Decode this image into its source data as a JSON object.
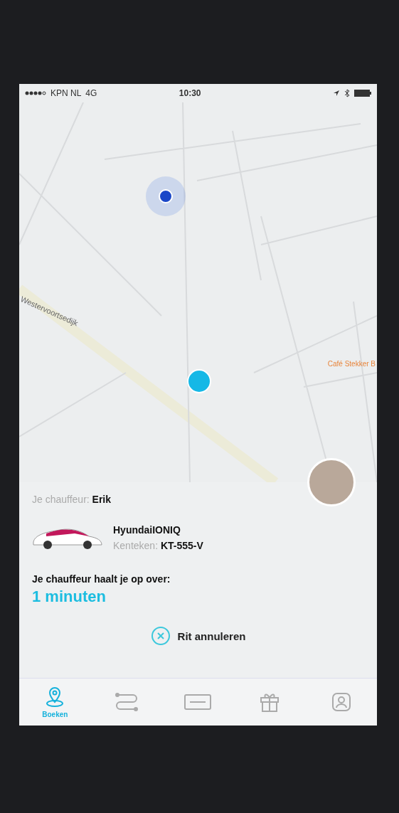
{
  "status_bar": {
    "carrier": "KPN NL",
    "network": "4G",
    "time": "10:30"
  },
  "map": {
    "street_label": "Westervoortsedijk",
    "poi_label": "Café Stekker B"
  },
  "driver": {
    "label": "Je chauffeur:",
    "name": "Erik"
  },
  "car": {
    "model": "HyundaiIONIQ",
    "plate_label": "Kenteken:",
    "plate": "KT-555-V"
  },
  "pickup": {
    "label": "Je chauffeur haalt je op over:",
    "eta": "1 minuten"
  },
  "cancel_button": {
    "label": "Rit annuleren"
  },
  "tabs": [
    {
      "kind": "pin",
      "label": "Boeken",
      "selected": true
    },
    {
      "kind": "route",
      "selected": false
    },
    {
      "kind": "card",
      "selected": false
    },
    {
      "kind": "gift",
      "selected": false
    },
    {
      "kind": "person",
      "selected": false
    }
  ]
}
